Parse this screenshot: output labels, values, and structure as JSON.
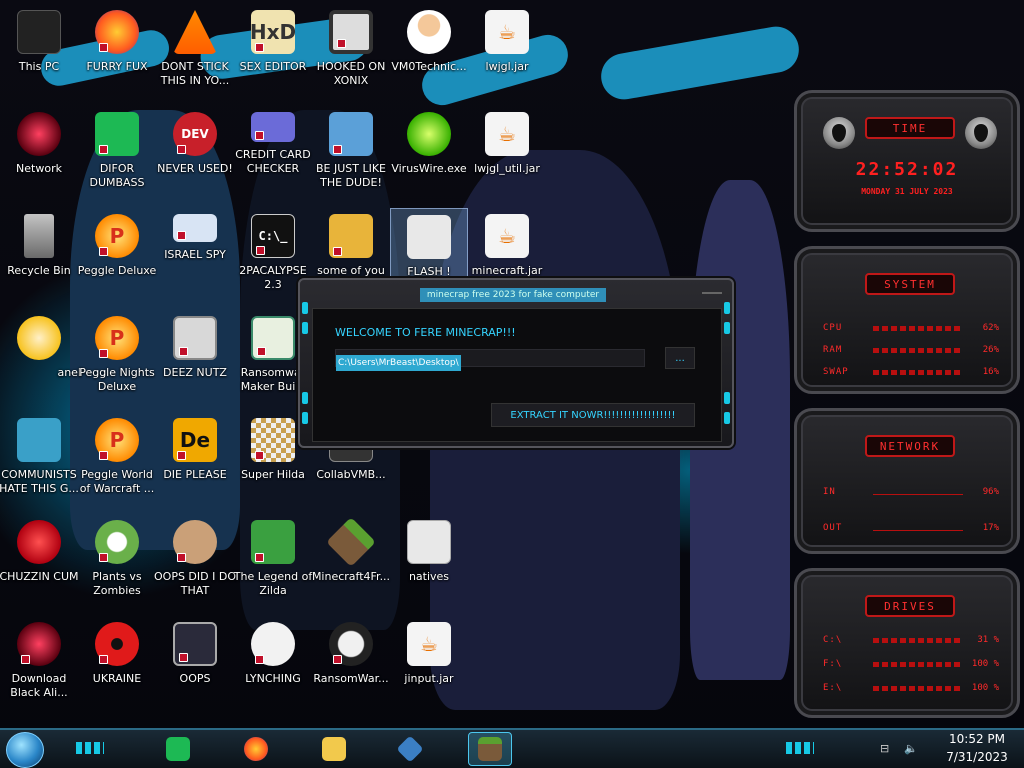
{
  "desktop": {
    "icons": [
      {
        "label": "This PC"
      },
      {
        "label": "FURRY FUX"
      },
      {
        "label": "DONT STICK THIS IN YO..."
      },
      {
        "label": "SEX EDITOR"
      },
      {
        "label": "HOOKED ON XONIX"
      },
      {
        "label": "VM0Technic..."
      },
      {
        "label": "lwjgl.jar"
      },
      {
        "label": "Network"
      },
      {
        "label": "DIFOR DUMBASS"
      },
      {
        "label": "NEVER USED!"
      },
      {
        "label": "CREDIT CARD CHECKER"
      },
      {
        "label": "BE JUST LIKE THE DUDE!"
      },
      {
        "label": "VirusWire.exe"
      },
      {
        "label": "lwjgl_util.jar"
      },
      {
        "label": "Recycle Bin"
      },
      {
        "label": "Peggle Deluxe"
      },
      {
        "label": "ISRAEL SPY"
      },
      {
        "label": "2PACALYPSE 2.3"
      },
      {
        "label": "some of you"
      },
      {
        "label": "FLASH !"
      },
      {
        "label": "minecraft.jar"
      },
      {
        "label": "anel"
      },
      {
        "label": "Peggle Nights Deluxe"
      },
      {
        "label": "DEEZ NUTZ"
      },
      {
        "label": "Ransomwar Maker Build"
      },
      {
        "label": "COMMUNISTS HATE THIS G..."
      },
      {
        "label": "Peggle World of Warcraft ..."
      },
      {
        "label": "DIE PLEASE"
      },
      {
        "label": "Super Hilda"
      },
      {
        "label": "CollabVMB..."
      },
      {
        "label": "CHUZZIN CUM"
      },
      {
        "label": "Plants vs Zombies"
      },
      {
        "label": "OOPS DID I DO THAT"
      },
      {
        "label": "The Legend of Zilda"
      },
      {
        "label": "Minecraft4Fr..."
      },
      {
        "label": "natives"
      },
      {
        "label": "Download Black Ali..."
      },
      {
        "label": "UKRAINE"
      },
      {
        "label": "OOPS"
      },
      {
        "label": "LYNCHING"
      },
      {
        "label": "RansomWar..."
      },
      {
        "label": "jinput.jar"
      }
    ]
  },
  "dialog": {
    "title": "minecrap free 2023 for fake computer",
    "welcome": "WELCOME TO FERE MINECRAP!!!",
    "path_value": "C:\\Users\\MrBeast\\Desktop\\",
    "browse_label": "...",
    "extract_label": "EXTRACT IT NOWR!!!!!!!!!!!!!!!!!!"
  },
  "widgets": {
    "time": {
      "header": "TIME",
      "clock": "22:52:02",
      "date": "MONDAY 31 JULY 2023"
    },
    "system": {
      "header": "SYSTEM",
      "rows": [
        {
          "key": "CPU",
          "value": "62%"
        },
        {
          "key": "RAM",
          "value": "26%"
        },
        {
          "key": "SWAP",
          "value": "16%"
        }
      ]
    },
    "network": {
      "header": "NETWORK",
      "rows": [
        {
          "key": "IN",
          "value": "96%"
        },
        {
          "key": "OUT",
          "value": "17%"
        }
      ]
    },
    "drives": {
      "header": "DRIVES",
      "rows": [
        {
          "key": "C:\\",
          "value": "31 %"
        },
        {
          "key": "F:\\",
          "value": "100 %"
        },
        {
          "key": "E:\\",
          "value": "100 %"
        }
      ]
    }
  },
  "taskbar": {
    "time": "10:52 PM",
    "date": "7/31/2023",
    "apps": [
      {
        "icon": "spotify-icon",
        "color": "#1db954"
      },
      {
        "icon": "firefox-icon",
        "color": "#ff7a1a"
      },
      {
        "icon": "file-explorer-icon",
        "color": "#f2c94c"
      },
      {
        "icon": "virtualbox-icon",
        "color": "#3b7fc4"
      },
      {
        "icon": "minecraft-icon",
        "color": "#5a8d3a"
      }
    ]
  },
  "colors": {
    "accent_cyan": "#35d4ff",
    "widget_red": "#ff2a2a",
    "selection_blue": "#2fa9d1"
  }
}
